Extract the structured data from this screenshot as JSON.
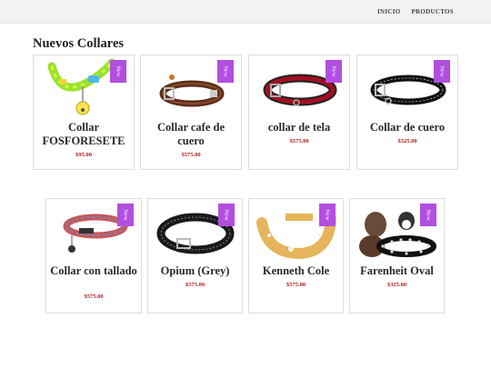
{
  "nav": {
    "items": [
      "INICIO",
      "PRODUCTOS"
    ]
  },
  "page_title": "Nuevos Collares",
  "badge_label": "New",
  "products": [
    {
      "name": "Collar FOSFORESETE",
      "price": "$95.00",
      "image": "neon-collar-image"
    },
    {
      "name": "Collar cafe de cuero",
      "price": "$575.00",
      "image": "brown-leather-collar-image"
    },
    {
      "name": "collar de tela",
      "price": "$575.00",
      "image": "red-fabric-collar-image"
    },
    {
      "name": "Collar de cuero",
      "price": "$325.00",
      "image": "black-leather-collar-image"
    },
    {
      "name": "Collar con tallado",
      "price": "$575.00",
      "image": "patterned-collar-image"
    },
    {
      "name": "Opium (Grey)",
      "price": "$575.00",
      "image": "black-collar-image"
    },
    {
      "name": "Kenneth Cole",
      "price": "$575.00",
      "image": "tan-collar-image"
    },
    {
      "name": "Farenheit Oval",
      "price": "$325.00",
      "image": "spiked-collar-dogs-image"
    }
  ],
  "colors": {
    "badge": "#b24ee0",
    "price": "#b31b1b",
    "topbar": "#f2f2f2"
  }
}
